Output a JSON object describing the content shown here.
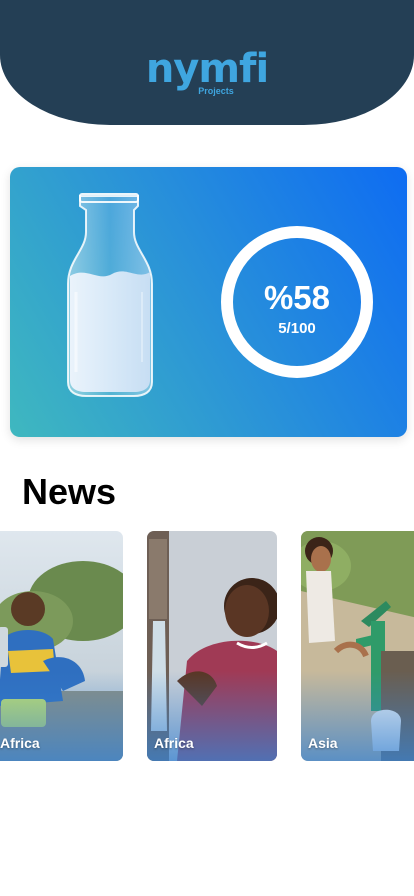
{
  "brand": {
    "logo_text": "nymfi",
    "logo_subtitle": "Projects",
    "colors": {
      "header_bg": "#243f55",
      "logo": "#3fa6e0",
      "accent": "#0e6cf2",
      "teal": "#3fb8bf"
    }
  },
  "progress": {
    "percent_label": "%58",
    "count_label": "5/100",
    "fill_fraction": 0.58,
    "icon": "milk-bottle-icon"
  },
  "news": {
    "title": "News",
    "items": [
      {
        "region": "Africa"
      },
      {
        "region": "Africa"
      },
      {
        "region": "Asia"
      }
    ]
  }
}
